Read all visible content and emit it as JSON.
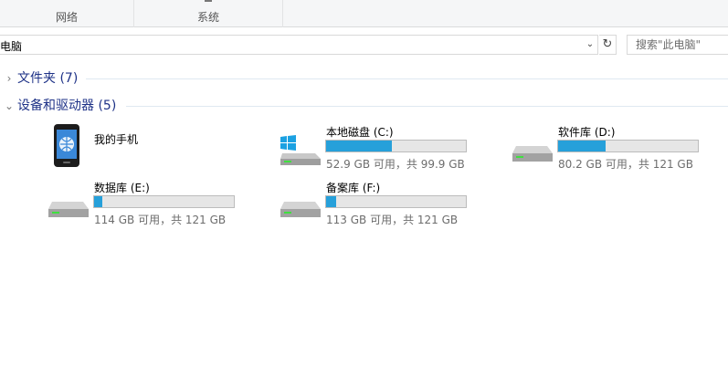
{
  "ribbon": {
    "groups": [
      {
        "label": "网络"
      },
      {
        "label": "系统"
      }
    ]
  },
  "address_bar": {
    "path": "电脑",
    "search_placeholder": "搜索\"此电脑\""
  },
  "groups": {
    "folders": {
      "title": "文件夹 (7)",
      "expanded": false
    },
    "devices": {
      "title": "设备和驱动器 (5)",
      "expanded": true
    }
  },
  "devices": [
    {
      "name": "我的手机",
      "icon": "phone-icon"
    },
    {
      "name": "本地磁盘 (C:)",
      "icon": "windows-drive-icon",
      "used_fraction": 0.47,
      "capacity": "52.9 GB 可用，共 99.9 GB"
    },
    {
      "name": "软件库 (D:)",
      "icon": "hard-drive-icon",
      "used_fraction": 0.34,
      "capacity": "80.2 GB 可用，共 121 GB"
    },
    {
      "name": "数据库 (E:)",
      "icon": "hard-drive-icon",
      "used_fraction": 0.06,
      "capacity": "114 GB 可用，共 121 GB"
    },
    {
      "name": "备案库 (F:)",
      "icon": "hard-drive-icon",
      "used_fraction": 0.07,
      "capacity": "113 GB 可用，共 121 GB"
    }
  ],
  "colors": {
    "accent": "#26a0da",
    "group_title": "#1e3287",
    "bar_bg": "#e6e6e6"
  }
}
